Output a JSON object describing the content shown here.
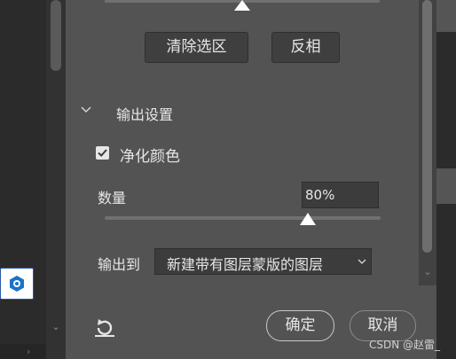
{
  "buttons": {
    "clear_selection": "清除选区",
    "invert": "反相",
    "ok": "确定",
    "cancel": "取消"
  },
  "output_settings": {
    "section_title": "输出设置",
    "decontaminate_label": "净化颜色",
    "decontaminate_checked": true,
    "amount_label": "数量",
    "amount_value": "80%",
    "amount_fraction": 0.8,
    "output_to_label": "输出到",
    "output_to_value": "新建带有图层蒙版的图层"
  },
  "watermark": "CSDN @赵雷_",
  "icons": [
    "chevron-down-icon",
    "checkmark-icon",
    "reset-icon",
    "app-icon"
  ],
  "colors": {
    "panel_bg": "#535353",
    "field_bg": "#3c3c3c",
    "text": "#e6e6e6"
  }
}
